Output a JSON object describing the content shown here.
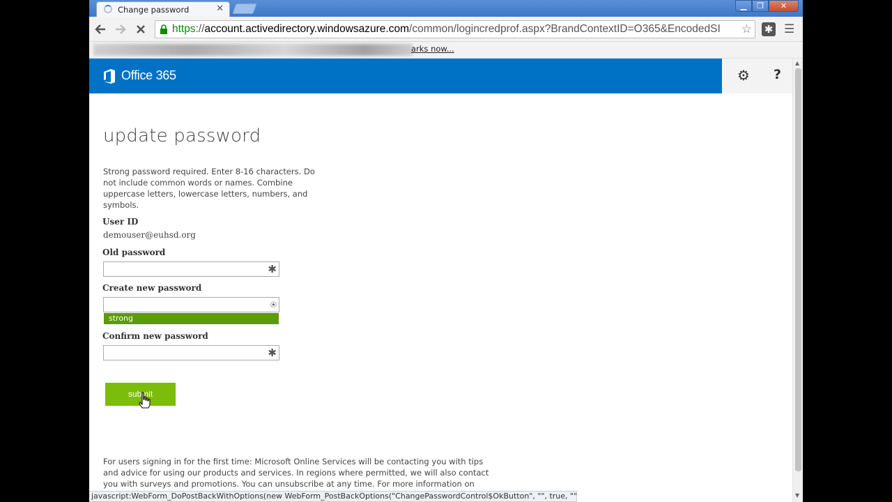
{
  "browser": {
    "tab_title": "Change password",
    "tab_close": "✕",
    "url_scheme": "https",
    "url_sep": "://",
    "url_host": "account.activedirectory.windowsazure.com",
    "url_path": "/common/logincredprof.aspx?BrandContextID=O365&EncodedSI",
    "bookmarks_link": "arks now...",
    "status_text": "javascript:WebForm_DoPostBackWithOptions(new WebForm_PostBackOptions(\"ChangePasswordControl$OkButton\", \"\", true, \"\", \"\", false, true))"
  },
  "header": {
    "logo_text": "Office 365",
    "brand_color": "#0072c6"
  },
  "form": {
    "title": "update password",
    "instructions": "Strong password required. Enter 8-16 characters. Do not include common words or names. Combine uppercase letters, lowercase letters, numbers, and symbols.",
    "userid_label": "User ID",
    "userid_value": "demouser@euhsd.org",
    "oldpw_label": "Old password",
    "newpw_label": "Create new password",
    "strength_text": "strong",
    "confirmpw_label": "Confirm new password",
    "submit_label": "submit",
    "accent_color": "#7cbc0a"
  },
  "footer": {
    "text": "For users signing in for the first time: Microsoft Online Services will be contacting you with tips and advice for using our products and services. In regions where permitted, we will also contact you with surveys and promotions. You can unsubscribe at any time. For more information on communication"
  }
}
